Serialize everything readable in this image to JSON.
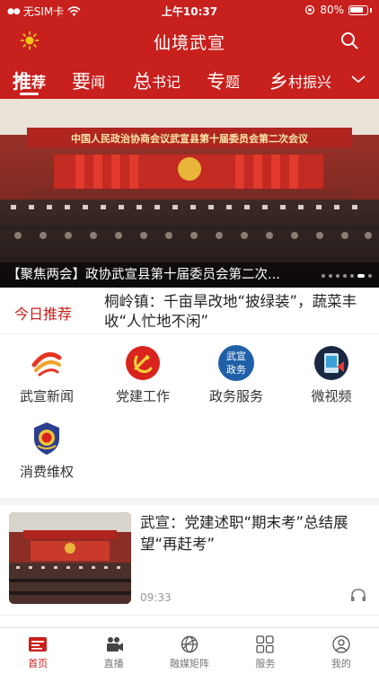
{
  "statusbar": {
    "carrier": "无SIM卡",
    "time": "上午10:37",
    "battery": "80%"
  },
  "header": {
    "title": "仙境武宣"
  },
  "tabs": [
    {
      "big": "推",
      "rest": "荐"
    },
    {
      "big": "要",
      "rest": "闻"
    },
    {
      "big": "总",
      "rest": "书记"
    },
    {
      "big": "专",
      "rest": "题"
    },
    {
      "big": "乡",
      "rest": "村振兴"
    }
  ],
  "banner": {
    "image_title": "中国人民政治协商会议武宣县第十届委员会第二次会议",
    "caption": "【聚焦两会】政协武宣县第十届委员会第二次..."
  },
  "today": {
    "label": "今日推荐",
    "headline": "桐岭镇：千亩旱改地“披绿装”，蔬菜丰收“人忙地不闲”"
  },
  "services": [
    {
      "label": "武宣新闻",
      "icon": "wuxuan-news-icon"
    },
    {
      "label": "党建工作",
      "icon": "party-building-icon"
    },
    {
      "label": "政务服务",
      "icon": "government-service-icon",
      "icon_text": "武宣政务"
    },
    {
      "label": "微视频",
      "icon": "micro-video-icon"
    },
    {
      "label": "消费维权",
      "icon": "consumer-rights-icon"
    }
  ],
  "news": [
    {
      "title": "武宣：党建述职“期末考”总结展望“再赶考”",
      "time": "09:33"
    }
  ],
  "bottomnav": [
    {
      "label": "首页",
      "icon": "home-icon"
    },
    {
      "label": "直播",
      "icon": "live-camera-icon"
    },
    {
      "label": "融媒矩阵",
      "icon": "media-matrix-icon"
    },
    {
      "label": "服务",
      "icon": "services-grid-icon"
    },
    {
      "label": "我的",
      "icon": "profile-icon"
    }
  ],
  "colors": {
    "brand": "#c8201d"
  }
}
